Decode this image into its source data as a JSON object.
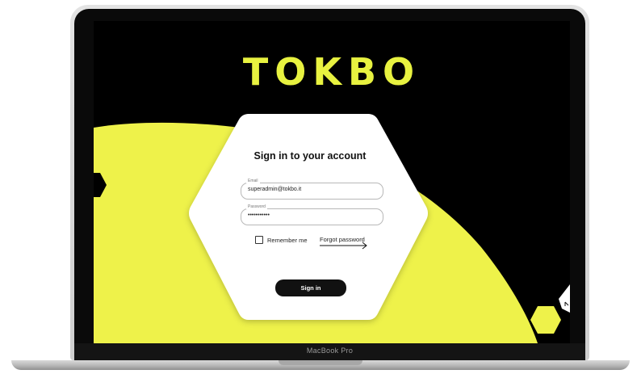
{
  "device": {
    "label": "MacBook Pro"
  },
  "app": {
    "logo_text": "TOKBO"
  },
  "login_form": {
    "title": "Sign in to your account",
    "email": {
      "label": "Email",
      "value": "superadmin@tokbo.it"
    },
    "password": {
      "label": "Password",
      "value": "•••••••••••"
    },
    "remember_label": "Remember me",
    "remember_checked": false,
    "forgot_label": "Forgot password",
    "submit_label": "Sign in"
  },
  "colors": {
    "accent_yellow": "#eef24a",
    "background": "#000000",
    "card": "#ffffff",
    "button": "#111111"
  },
  "icons": [
    "arrow-right-icon",
    "hexagon-badge-icon",
    "checkbox-icon"
  ]
}
